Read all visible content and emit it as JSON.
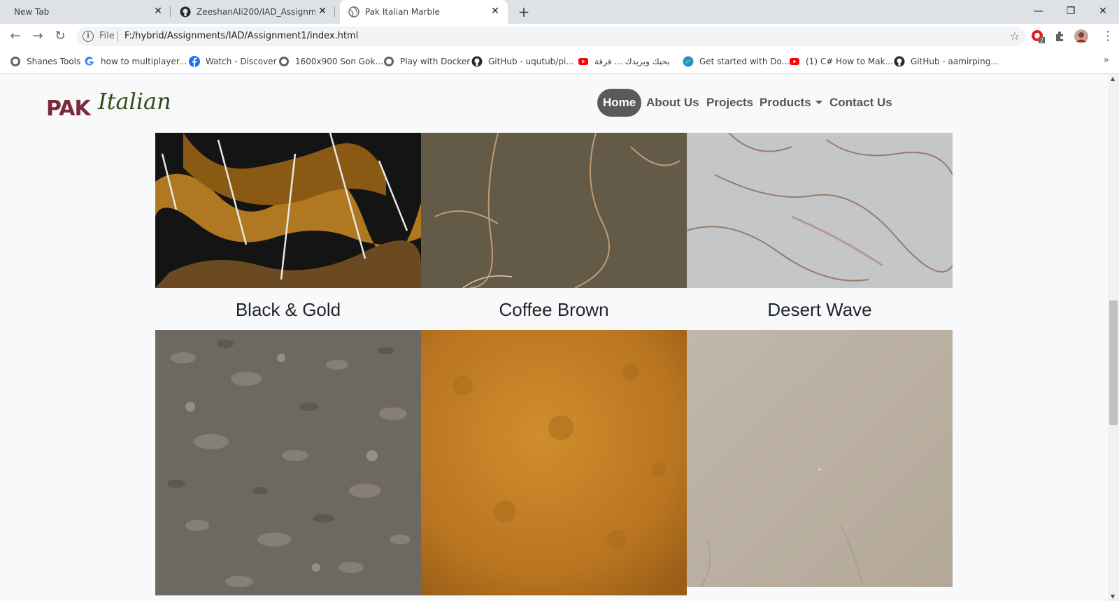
{
  "browser": {
    "tabs": [
      {
        "title": "New Tab",
        "active": false
      },
      {
        "title": "ZeeshanAli200/IAD_Assignment1",
        "active": false
      },
      {
        "title": "Pak Italian Marble",
        "active": true
      }
    ],
    "address": {
      "scheme": "File",
      "url": "F:/hybrid/Assignments/IAD/Assignment1/index.html"
    },
    "extension_badge": "2",
    "bookmarks": [
      "Shanes Tools",
      "how to multiplayer...",
      "Watch - Discover",
      "1600x900 Son Gok...",
      "Play with Docker",
      "GitHub - uqutub/pi...",
      "بحبك وبريدك ... فرقة",
      "Get started with Do...",
      "(1) C# How to Mak...",
      "GitHub - aamirping..."
    ]
  },
  "site": {
    "logo": {
      "mark": "PAK",
      "word": "Italian"
    },
    "nav": [
      {
        "label": "Home",
        "active": true
      },
      {
        "label": "About Us",
        "active": false
      },
      {
        "label": "Projects",
        "active": false
      },
      {
        "label": "Products",
        "active": false,
        "dropdown": true
      },
      {
        "label": "Contact Us",
        "active": false
      }
    ],
    "products": [
      {
        "name": "Black & Gold"
      },
      {
        "name": "Coffee Brown"
      },
      {
        "name": "Desert Wave"
      }
    ]
  },
  "colors": {
    "nav_active_bg": "#5a5a5a",
    "nav_text": "#555555",
    "logo_mark": "#7a2a3a",
    "logo_word": "#3b4a1c"
  }
}
